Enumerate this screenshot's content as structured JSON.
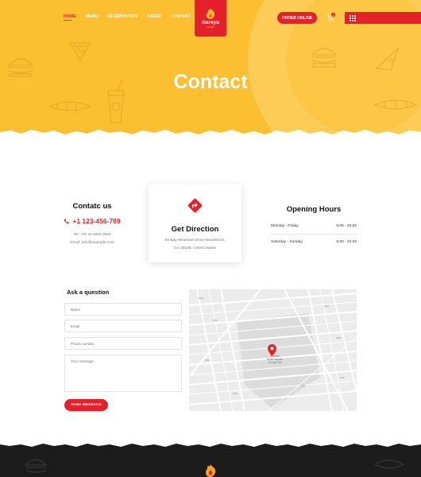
{
  "nav": {
    "items": [
      "HOME",
      "MENU",
      "RESERVATION",
      "PAGES",
      "CONTACT"
    ]
  },
  "brand": {
    "name": "Gareya",
    "sub": "FOOD"
  },
  "header": {
    "order_label": "ORDER ONLINE",
    "cart_count": "0"
  },
  "hero": {
    "title": "Contact"
  },
  "contact": {
    "title": "Contatc us",
    "phone": "+1 123-456-789",
    "tel": "Tel: +91 11 4050 0000",
    "email": "Email: info@example.com"
  },
  "direction": {
    "title": "Get Direction",
    "address_line1": "85 Bay Meadows Drive Woodstock,",
    "address_line2": "GA 30188, United States"
  },
  "hours": {
    "title": "Opening Hours",
    "rows": [
      {
        "days": "Monday - Friday",
        "time": "9.00 - 20.00"
      },
      {
        "days": "Saturday - Sunday",
        "time": "8.00 - 22.00"
      }
    ]
  },
  "form": {
    "title": "Ask a question",
    "name_placeholder": "Name",
    "email_placeholder": "Email",
    "phone_placeholder": "Phone number",
    "message_placeholder": "Your message",
    "send_label": "SEND MESSAGE"
  },
  "map": {
    "label_line1": "Broward",
    "label_line2": "North Houston",
    "label_line3": "County Park"
  },
  "colors": {
    "accent": "#e4212b",
    "hero_bg": "#fcbf32",
    "footer_bg": "#1c1c1c"
  }
}
